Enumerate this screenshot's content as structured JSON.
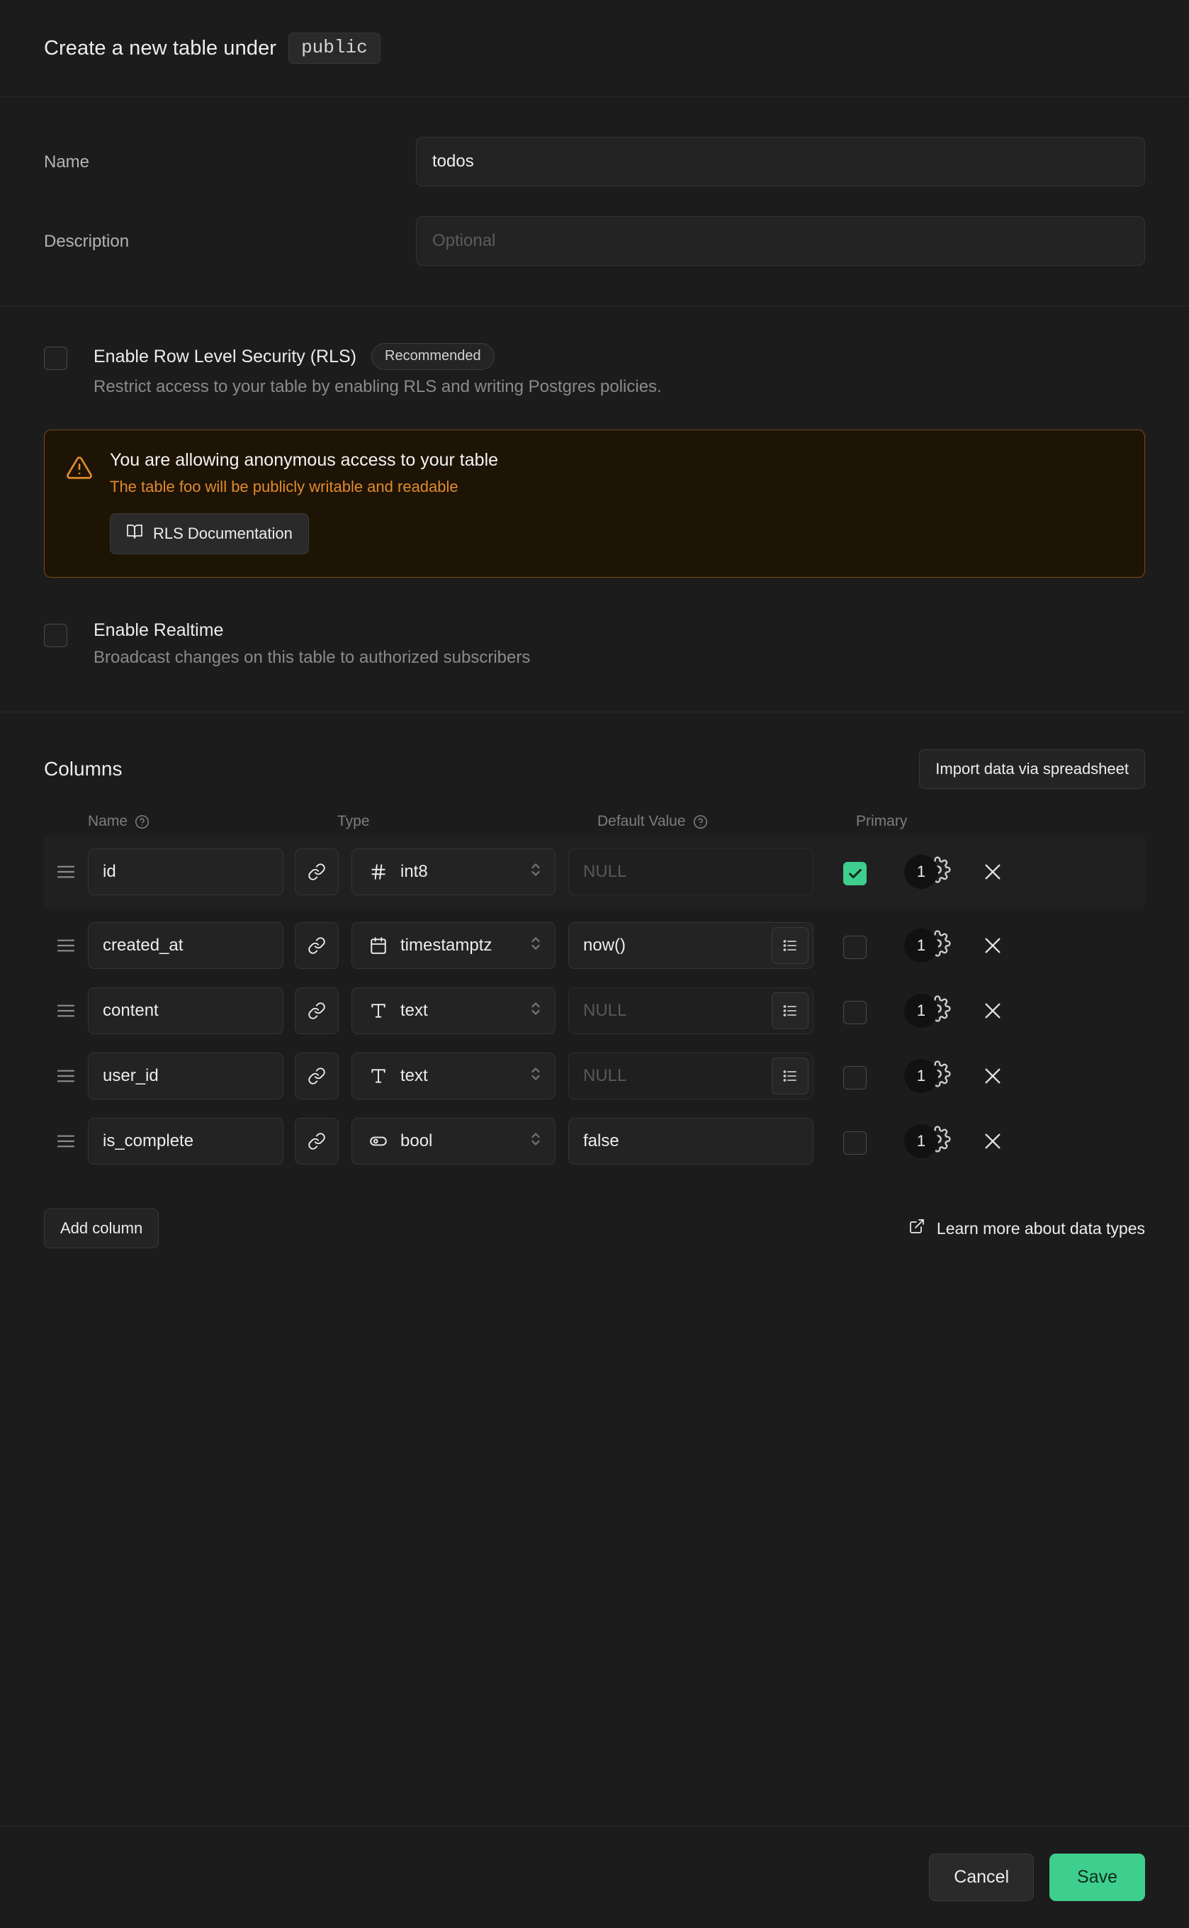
{
  "header": {
    "title": "Create a new table under",
    "schema": "public"
  },
  "form": {
    "name_label": "Name",
    "name_value": "todos",
    "description_label": "Description",
    "description_placeholder": "Optional"
  },
  "rls": {
    "label": "Enable Row Level Security (RLS)",
    "badge": "Recommended",
    "description": "Restrict access to your table by enabling RLS and writing Postgres policies.",
    "checked": false
  },
  "alert": {
    "title": "You are allowing anonymous access to your table",
    "subtitle": "The table foo will be publicly writable and readable",
    "button_label": "RLS Documentation",
    "border_color": "#7c4a11",
    "background_color": "#1e1405",
    "accent_color": "#e08a2e"
  },
  "realtime": {
    "label": "Enable Realtime",
    "description": "Broadcast changes on this table to authorized subscribers",
    "checked": false
  },
  "columns_section": {
    "title": "Columns",
    "import_label": "Import data via spreadsheet",
    "headers": {
      "name": "Name",
      "type": "Type",
      "default": "Default Value",
      "primary": "Primary"
    },
    "add_column_label": "Add column",
    "learn_more_label": "Learn more about data types",
    "rows": [
      {
        "name": "id",
        "type": "int8",
        "type_icon": "hash-icon",
        "default": "NULL",
        "default_is_placeholder": true,
        "has_default_list_button": false,
        "primary": true,
        "settings_count": "1"
      },
      {
        "name": "created_at",
        "type": "timestamptz",
        "type_icon": "calendar-icon",
        "default": "now()",
        "default_is_placeholder": false,
        "has_default_list_button": true,
        "primary": false,
        "settings_count": "1"
      },
      {
        "name": "content",
        "type": "text",
        "type_icon": "text-icon",
        "default": "NULL",
        "default_is_placeholder": true,
        "has_default_list_button": true,
        "primary": false,
        "settings_count": "1"
      },
      {
        "name": "user_id",
        "type": "text",
        "type_icon": "text-icon",
        "default": "NULL",
        "default_is_placeholder": true,
        "has_default_list_button": true,
        "primary": false,
        "settings_count": "1"
      },
      {
        "name": "is_complete",
        "type": "bool",
        "type_icon": "toggle-icon",
        "default": "false",
        "default_is_placeholder": false,
        "has_default_list_button": false,
        "primary": false,
        "settings_count": "1"
      }
    ]
  },
  "footer": {
    "cancel_label": "Cancel",
    "save_label": "Save",
    "save_color": "#3ecf8e"
  }
}
